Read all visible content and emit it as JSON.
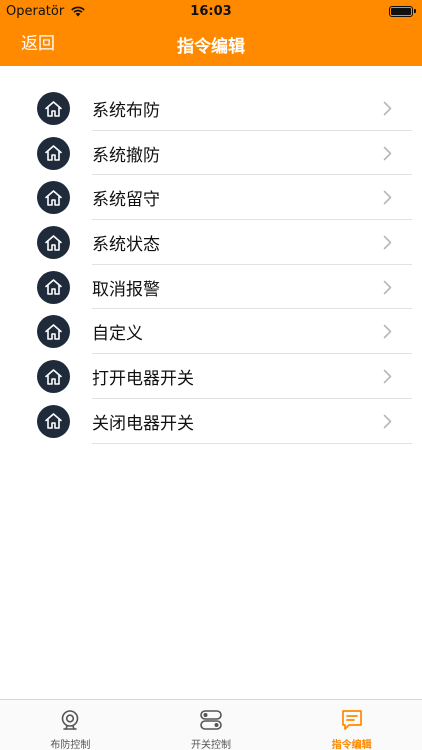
{
  "status_bar": {
    "carrier": "Operatör",
    "time": "16:03"
  },
  "nav": {
    "back_label": "返回",
    "title": "指令编辑"
  },
  "list": {
    "items": [
      {
        "label": "系统布防",
        "icon": "home-icon"
      },
      {
        "label": "系统撤防",
        "icon": "home-icon"
      },
      {
        "label": "系统留守",
        "icon": "home-icon"
      },
      {
        "label": "系统状态",
        "icon": "home-icon"
      },
      {
        "label": "取消报警",
        "icon": "home-icon"
      },
      {
        "label": "自定义",
        "icon": "home-icon"
      },
      {
        "label": "打开电器开关",
        "icon": "home-icon"
      },
      {
        "label": "关闭电器开关",
        "icon": "home-icon"
      }
    ]
  },
  "tab_bar": {
    "tabs": [
      {
        "label": "布防控制",
        "icon": "camera-icon",
        "active": false
      },
      {
        "label": "开关控制",
        "icon": "switch-icon",
        "active": false
      },
      {
        "label": "指令编辑",
        "icon": "message-icon",
        "active": true
      }
    ]
  },
  "colors": {
    "accent": "#FF8A00",
    "icon_bg": "#1f2a3a",
    "active_tab": "#FF8A00",
    "inactive_tab": "#555555"
  }
}
